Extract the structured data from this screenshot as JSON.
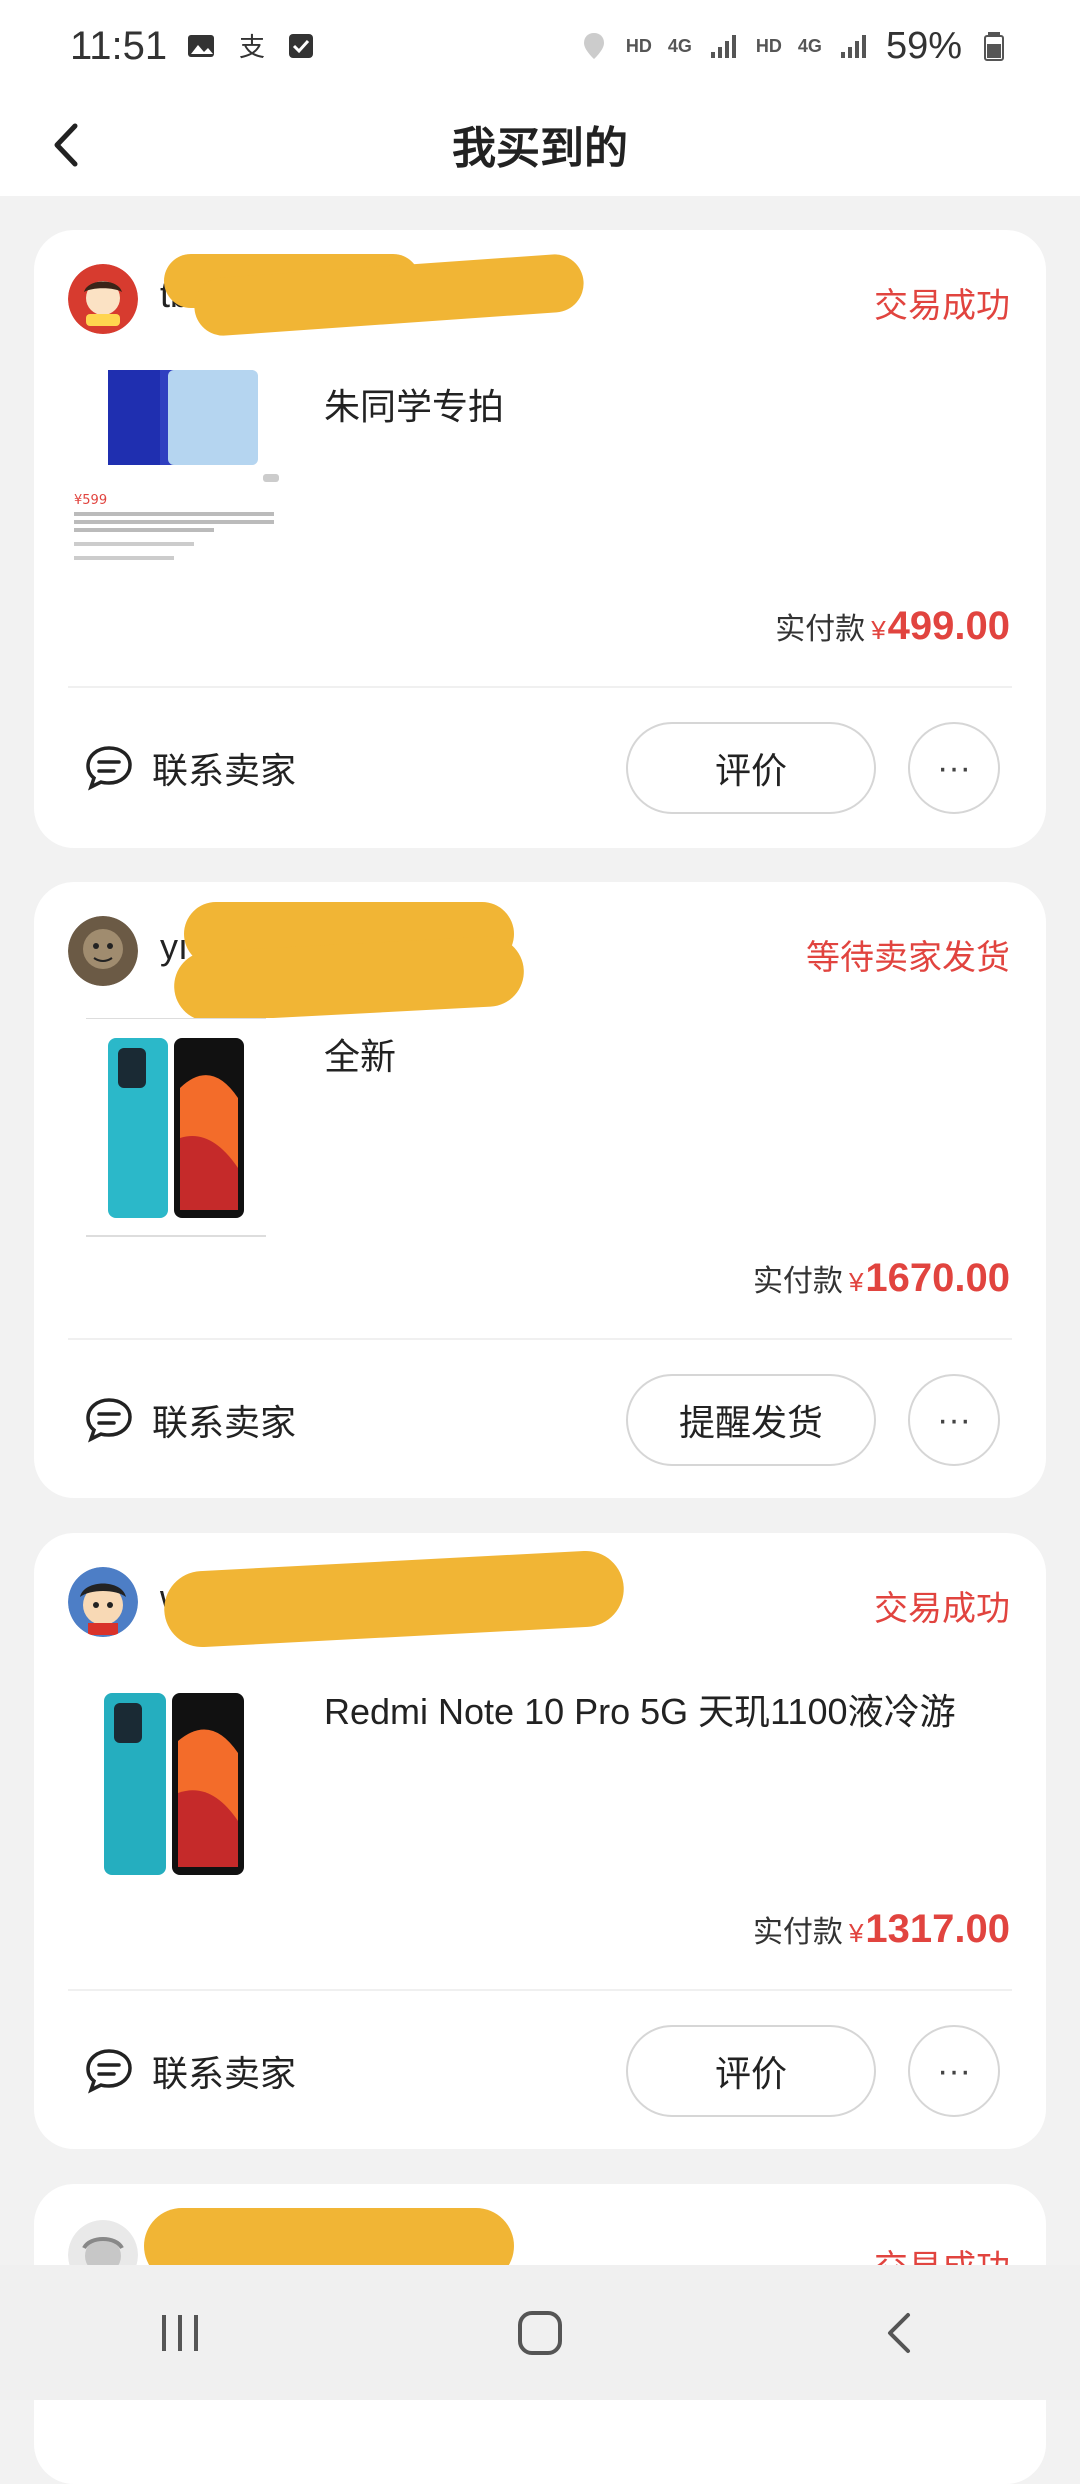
{
  "status": {
    "time": "11:51",
    "left_icons": [
      "image-icon",
      "alipay-icon",
      "checkbox-icon"
    ],
    "right_icons": [
      "location-icon",
      "hd-icon",
      "4g-icon",
      "signal-icon",
      "hd-icon",
      "4g-icon",
      "signal-icon"
    ],
    "battery": "59%"
  },
  "header": {
    "title": "我买到的"
  },
  "orders": [
    {
      "seller": "tb56",
      "status": "交易成功",
      "product_title": "朱同学专拍",
      "price_label": "实付款",
      "currency": "¥",
      "price": "499.00",
      "contact_label": "联系卖家",
      "action_label": "评价",
      "more_label": "···",
      "thumb_price": "¥599"
    },
    {
      "seller": "yı",
      "status": "等待卖家发货",
      "product_title": "全新",
      "price_label": "实付款",
      "currency": "¥",
      "price": "1670.00",
      "contact_label": "联系卖家",
      "action_label": "提醒发货",
      "more_label": "···"
    },
    {
      "seller": "w",
      "status": "交易成功",
      "product_title": "Redmi Note 10 Pro 5G 天玑1100液冷游",
      "price_label": "实付款",
      "currency": "¥",
      "price": "1317.00",
      "contact_label": "联系卖家",
      "action_label": "评价",
      "more_label": "···"
    },
    {
      "status": "交易成功"
    }
  ],
  "colors": {
    "accent": "#e1443f",
    "redaction": "#f1b535",
    "background": "#f2f2f2"
  }
}
